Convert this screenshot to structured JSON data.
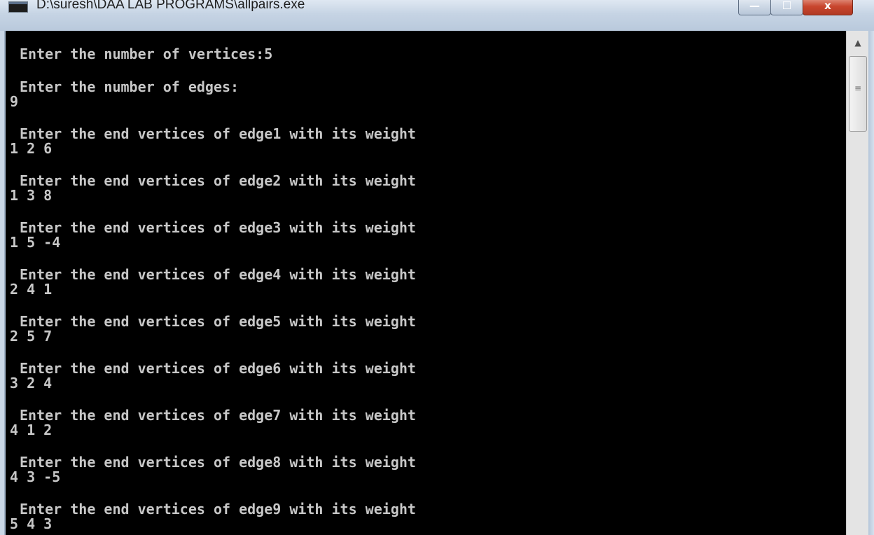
{
  "window": {
    "title": "D:\\suresh\\DAA LAB PROGRAMS\\allpairs.exe",
    "controls": {
      "minimize": "—",
      "maximize": "☐",
      "close": "x"
    }
  },
  "console": {
    "lines": [
      "Enter the number of vertices:5",
      "Enter the number of edges:",
      "9",
      "Enter the end vertices of edge1 with its weight",
      "1 2 6",
      "Enter the end vertices of edge2 with its weight",
      "1 3 8",
      "Enter the end vertices of edge3 with its weight",
      "1 5 -4",
      "Enter the end vertices of edge4 with its weight",
      "2 4 1",
      "Enter the end vertices of edge5 with its weight",
      "2 5 7",
      "Enter the end vertices of edge6 with its weight",
      "3 2 4",
      "Enter the end vertices of edge7 with its weight",
      "4 1 2",
      "Enter the end vertices of edge8 with its weight",
      "4 3 -5",
      "Enter the end vertices of edge9 with its weight",
      "5 4 3"
    ]
  },
  "scrollbar": {
    "up_arrow": "▲",
    "grip": "≡"
  }
}
